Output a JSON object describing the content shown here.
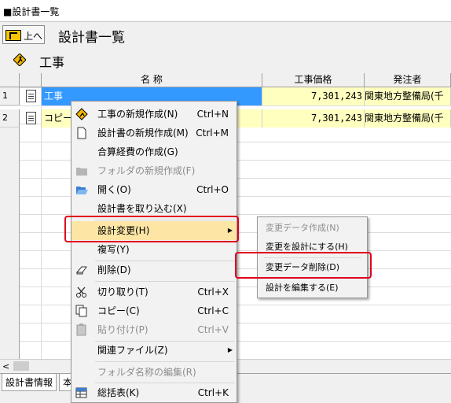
{
  "window": {
    "title": "■設計書一覧"
  },
  "toolbar": {
    "up_label": "上へ",
    "page_title": "設計書一覧"
  },
  "section": {
    "title": "工事",
    "icon": "construction-sign-icon"
  },
  "table": {
    "headers": [
      "名 称",
      "工事価格",
      "発注者"
    ],
    "rows": [
      {
        "num": "1",
        "name": "工事",
        "price": "7,301,243",
        "client": "関東地方整備局(千"
      },
      {
        "num": "2",
        "name": "コピー",
        "price": "7,301,243",
        "client": "関東地方整備局(千"
      }
    ]
  },
  "tabs": [
    "設計書情報",
    "本"
  ],
  "context_menu": {
    "items": [
      {
        "label": "工事の新規作成(N)",
        "shortcut": "Ctrl+N",
        "enabled": true,
        "icon": "construction-sign-icon"
      },
      {
        "label": "設計書の新規作成(M)",
        "shortcut": "Ctrl+M",
        "enabled": true,
        "icon": "document-icon"
      },
      {
        "label": "合算経費の作成(G)",
        "shortcut": "",
        "enabled": true
      },
      {
        "label": "フォルダの新規作成(F)",
        "shortcut": "",
        "enabled": false,
        "icon": "folder-icon"
      },
      {
        "label": "開く(O)",
        "shortcut": "Ctrl+O",
        "enabled": true,
        "icon": "open-folder-icon"
      },
      {
        "label": "設計書を取り込む(X)",
        "shortcut": "",
        "enabled": true
      },
      {
        "label": "設計変更(H)",
        "shortcut": "",
        "enabled": true,
        "highlighted": true,
        "submenu": true
      },
      {
        "label": "複写(Y)",
        "shortcut": "",
        "enabled": true
      },
      {
        "label": "削除(D)",
        "shortcut": "",
        "enabled": true,
        "icon": "eraser-icon"
      },
      {
        "label": "切り取り(T)",
        "shortcut": "Ctrl+X",
        "enabled": true,
        "icon": "scissors-icon"
      },
      {
        "label": "コピー(C)",
        "shortcut": "Ctrl+C",
        "enabled": true,
        "icon": "copy-icon"
      },
      {
        "label": "貼り付け(P)",
        "shortcut": "Ctrl+V",
        "enabled": false,
        "icon": "paste-icon"
      },
      {
        "label": "関連ファイル(Z)",
        "shortcut": "",
        "enabled": true,
        "submenu": true
      },
      {
        "label": "フォルダ名称の編集(R)",
        "shortcut": "",
        "enabled": false
      },
      {
        "label": "総括表(K)",
        "shortcut": "Ctrl+K",
        "enabled": true,
        "icon": "summary-table-icon"
      }
    ]
  },
  "submenu": {
    "items": [
      {
        "label": "変更データ作成(N)",
        "enabled": false
      },
      {
        "label": "変更を設計にする(H)",
        "enabled": true
      },
      {
        "label": "変更データ削除(D)",
        "enabled": true,
        "emphasized": true
      },
      {
        "label": "設計を編集する(E)",
        "enabled": true
      }
    ]
  },
  "colors": {
    "selection": "#3399ff",
    "menu_highlight": "#fde6a5",
    "annotation_red": "#e0001b",
    "row_yellow": "#ffffc0"
  }
}
